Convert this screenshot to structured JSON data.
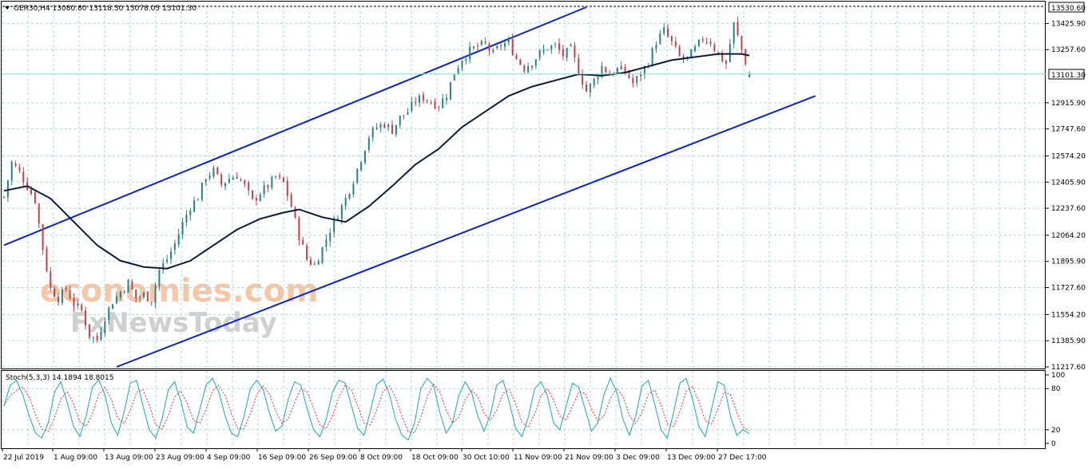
{
  "colors": {
    "grid": "#9fdcdc",
    "frame": "#000000",
    "up_candle": "#2a7f86",
    "down_candle": "#c0404b",
    "ma": "#0a1a3a",
    "channel": "#0a22c8",
    "stoch_main": "#1aa6b2",
    "stoch_signal": "#e0303a",
    "watermark_1": "#f4b48a",
    "watermark_2": "#bdbdbd"
  },
  "header": {
    "symbol_info": "GER30,H4  13080.80 13118.30 13078.05 13101.30"
  },
  "price_tags": {
    "top_label": "13530.60",
    "current_label": "13101.30"
  },
  "stoch_header": {
    "text": "Stoch(5,3,3) 14.1894 18.8015"
  },
  "watermark": {
    "line1": "economies.com",
    "line2": "FxNewsToday"
  },
  "chart_data": {
    "type": "candlestick",
    "symbol": "GER30",
    "timeframe": "H4",
    "ohlc_last": {
      "open": 13080.8,
      "high": 13118.3,
      "low": 13078.05,
      "close": 13101.3
    },
    "ylim": [
      11217.6,
      13530.6
    ],
    "y_ticks": [
      13425.9,
      13257.6,
      13101.3,
      12915.9,
      12747.6,
      12574.2,
      12405.9,
      12237.6,
      12064.2,
      11895.9,
      11727.6,
      11554.2,
      11385.9,
      11217.6
    ],
    "x_labels": [
      "22 Jul 2019",
      "1 Aug 09:00",
      "13 Aug 09:00",
      "23 Aug 09:00",
      "4 Sep 09:00",
      "16 Sep 09:00",
      "26 Sep 09:00",
      "8 Oct 09:00",
      "18 Oct 09:00",
      "30 Oct 10:00",
      "11 Nov 09:00",
      "21 Nov 09:00",
      "3 Dec 09:00",
      "13 Dec 09:00",
      "27 Dec 17:00"
    ],
    "close_path": [
      [
        0,
        12310
      ],
      [
        2,
        12530
      ],
      [
        4,
        12470
      ],
      [
        6,
        12380
      ],
      [
        8,
        12290
      ],
      [
        10,
        11980
      ],
      [
        12,
        11720
      ],
      [
        14,
        11660
      ],
      [
        16,
        11720
      ],
      [
        18,
        11620
      ],
      [
        20,
        11580
      ],
      [
        22,
        11420
      ],
      [
        24,
        11390
      ],
      [
        26,
        11540
      ],
      [
        28,
        11640
      ],
      [
        30,
        11700
      ],
      [
        32,
        11760
      ],
      [
        34,
        11660
      ],
      [
        36,
        11680
      ],
      [
        38,
        11650
      ],
      [
        40,
        11840
      ],
      [
        42,
        11910
      ],
      [
        44,
        12010
      ],
      [
        46,
        12140
      ],
      [
        48,
        12250
      ],
      [
        50,
        12310
      ],
      [
        52,
        12440
      ],
      [
        54,
        12480
      ],
      [
        56,
        12390
      ],
      [
        58,
        12430
      ],
      [
        60,
        12450
      ],
      [
        62,
        12380
      ],
      [
        64,
        12280
      ],
      [
        66,
        12340
      ],
      [
        68,
        12380
      ],
      [
        70,
        12440
      ],
      [
        72,
        12400
      ],
      [
        74,
        12250
      ],
      [
        76,
        12060
      ],
      [
        78,
        11910
      ],
      [
        80,
        11870
      ],
      [
        82,
        11980
      ],
      [
        84,
        12100
      ],
      [
        86,
        12200
      ],
      [
        88,
        12300
      ],
      [
        90,
        12420
      ],
      [
        92,
        12560
      ],
      [
        94,
        12700
      ],
      [
        96,
        12760
      ],
      [
        98,
        12780
      ],
      [
        100,
        12740
      ],
      [
        102,
        12820
      ],
      [
        104,
        12860
      ],
      [
        106,
        12930
      ],
      [
        108,
        12950
      ],
      [
        110,
        12920
      ],
      [
        112,
        12900
      ],
      [
        114,
        12970
      ],
      [
        116,
        13110
      ],
      [
        118,
        13200
      ],
      [
        120,
        13250
      ],
      [
        122,
        13280
      ],
      [
        124,
        13290
      ],
      [
        126,
        13230
      ],
      [
        128,
        13290
      ],
      [
        130,
        13300
      ],
      [
        132,
        13200
      ],
      [
        134,
        13140
      ],
      [
        136,
        13180
      ],
      [
        138,
        13230
      ],
      [
        140,
        13270
      ],
      [
        142,
        13280
      ],
      [
        144,
        13220
      ],
      [
        146,
        13260
      ],
      [
        148,
        13120
      ],
      [
        150,
        12990
      ],
      [
        152,
        13060
      ],
      [
        154,
        13150
      ],
      [
        156,
        13100
      ],
      [
        158,
        13130
      ],
      [
        160,
        13120
      ],
      [
        162,
        13040
      ],
      [
        164,
        13100
      ],
      [
        166,
        13180
      ],
      [
        168,
        13310
      ],
      [
        170,
        13380
      ],
      [
        172,
        13300
      ],
      [
        174,
        13210
      ],
      [
        176,
        13200
      ],
      [
        178,
        13260
      ],
      [
        180,
        13330
      ],
      [
        182,
        13310
      ],
      [
        184,
        13220
      ],
      [
        186,
        13170
      ],
      [
        188,
        13420
      ],
      [
        190,
        13260
      ],
      [
        192,
        13101.3
      ]
    ],
    "moving_average": [
      [
        0,
        12350
      ],
      [
        6,
        12380
      ],
      [
        12,
        12300
      ],
      [
        18,
        12150
      ],
      [
        24,
        12000
      ],
      [
        30,
        11900
      ],
      [
        36,
        11860
      ],
      [
        42,
        11850
      ],
      [
        48,
        11900
      ],
      [
        54,
        12000
      ],
      [
        60,
        12100
      ],
      [
        66,
        12170
      ],
      [
        72,
        12210
      ],
      [
        76,
        12230
      ],
      [
        82,
        12180
      ],
      [
        88,
        12150
      ],
      [
        94,
        12250
      ],
      [
        100,
        12380
      ],
      [
        106,
        12520
      ],
      [
        112,
        12620
      ],
      [
        118,
        12760
      ],
      [
        124,
        12860
      ],
      [
        130,
        12960
      ],
      [
        136,
        13020
      ],
      [
        142,
        13060
      ],
      [
        148,
        13100
      ],
      [
        154,
        13090
      ],
      [
        160,
        13110
      ],
      [
        166,
        13150
      ],
      [
        172,
        13190
      ],
      [
        178,
        13210
      ],
      [
        184,
        13230
      ],
      [
        190,
        13230
      ],
      [
        192,
        13220
      ]
    ],
    "channel_upper": [
      [
        0,
        12000
      ],
      [
        150,
        13530.6
      ]
    ],
    "channel_lower": [
      [
        29,
        11217.6
      ],
      [
        209,
        12960
      ]
    ],
    "stochastic": {
      "name": "Stoch(5,3,3)",
      "main_last": 14.1894,
      "signal_last": 18.8015,
      "ylim": [
        0,
        100
      ],
      "levels": [
        20,
        80
      ],
      "y_ticks": [
        100,
        80,
        20,
        0
      ],
      "main": [
        55,
        85,
        92,
        70,
        40,
        15,
        8,
        30,
        75,
        90,
        60,
        25,
        10,
        40,
        82,
        93,
        70,
        30,
        12,
        45,
        88,
        92,
        55,
        20,
        8,
        35,
        78,
        90,
        62,
        24,
        15,
        50,
        85,
        95,
        75,
        40,
        15,
        10,
        40,
        80,
        92,
        80,
        45,
        18,
        25,
        65,
        90,
        85,
        50,
        20,
        10,
        35,
        75,
        92,
        88,
        55,
        22,
        12,
        48,
        86,
        94,
        72,
        35,
        12,
        5,
        30,
        80,
        95,
        85,
        45,
        15,
        30,
        70,
        90,
        75,
        40,
        18,
        42,
        85,
        92,
        60,
        22,
        10,
        38,
        80,
        90,
        70,
        30,
        20,
        55,
        88,
        82,
        50,
        18,
        30,
        72,
        95,
        75,
        35,
        12,
        40,
        84,
        92,
        58,
        20,
        8,
        45,
        88,
        95,
        65,
        25,
        10,
        50,
        90,
        85,
        40,
        12,
        20,
        14.19
      ]
    }
  }
}
